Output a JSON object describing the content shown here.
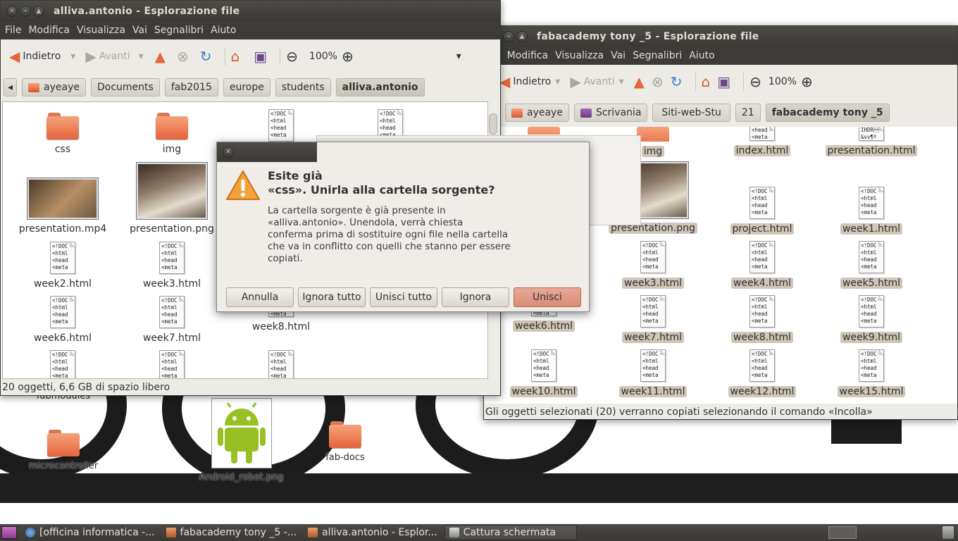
{
  "desktop": {
    "icons": [
      {
        "name": "microcontroller",
        "type": "folder"
      },
      {
        "name": "Android_robot.png",
        "type": "image"
      },
      {
        "name": "fab-docs",
        "type": "folder"
      }
    ],
    "partial_label": "fabmodules"
  },
  "window_left": {
    "title": "alliva.antonio - Esplorazione file",
    "menu": [
      "File",
      "Modifica",
      "Visualizza",
      "Vai",
      "Segnalibri",
      "Aiuto"
    ],
    "toolbar": {
      "back": "Indietro",
      "forward": "Avanti",
      "zoom": "100%"
    },
    "path": [
      "ayeaye",
      "Documents",
      "fab2015",
      "europe",
      "students",
      "alliva.antonio"
    ],
    "items": [
      {
        "name": "css",
        "type": "folder"
      },
      {
        "name": "img",
        "type": "folder"
      },
      {
        "name": "",
        "type": "html"
      },
      {
        "name": "",
        "type": "html"
      },
      {
        "name": "presentation.mp4",
        "type": "video"
      },
      {
        "name": "presentation.png",
        "type": "image"
      },
      {
        "name": "week2.html",
        "type": "html"
      },
      {
        "name": "week3.html",
        "type": "html"
      },
      {
        "name": "week6.html",
        "type": "html"
      },
      {
        "name": "week7.html",
        "type": "html"
      },
      {
        "name": "week8.html",
        "type": "html"
      },
      {
        "name": "",
        "type": "html"
      },
      {
        "name": "",
        "type": "html"
      },
      {
        "name": "",
        "type": "html"
      }
    ],
    "doc_preview": [
      "<!DOC",
      "<html",
      "<head",
      "<meta"
    ],
    "status": "20 oggetti, 6,6 GB di spazio libero"
  },
  "window_right": {
    "title": "fabacademy tony _5 - Esplorazione file",
    "menu": [
      "e",
      "Modifica",
      "Visualizza",
      "Vai",
      "Segnalibri",
      "Aiuto"
    ],
    "toolbar": {
      "back": "Indietro",
      "forward": "Avanti",
      "zoom": "100%"
    },
    "path": [
      "ayeaye",
      "Scrivania",
      "Siti-web-Stu",
      "21",
      "fabacademy tony _5"
    ],
    "items": [
      {
        "name": "img",
        "type": "folder"
      },
      {
        "name": "index.html",
        "type": "html"
      },
      {
        "name": "presentation.html",
        "type": "html"
      },
      {
        "name": "presentation.png",
        "type": "image"
      },
      {
        "name": "project.html",
        "type": "html"
      },
      {
        "name": "week1.html",
        "type": "html"
      },
      {
        "name": "week3.html",
        "type": "html"
      },
      {
        "name": "week4.html",
        "type": "html"
      },
      {
        "name": "week5.html",
        "type": "html"
      },
      {
        "name": "week6.html",
        "type": "html"
      },
      {
        "name": "week7.html",
        "type": "html"
      },
      {
        "name": "week8.html",
        "type": "html"
      },
      {
        "name": "week9.html",
        "type": "html"
      },
      {
        "name": "week10.html",
        "type": "html"
      },
      {
        "name": "week11.html",
        "type": "html"
      },
      {
        "name": "week12.html",
        "type": "html"
      },
      {
        "name": "week15.html",
        "type": "html"
      }
    ],
    "preview_partial": [
      "<head",
      "<meta"
    ],
    "preview_png": [
      "IHDR\u0001",
      "&vv¶º"
    ],
    "status": "Gli oggetti selezionati (20) verranno copiati selezionando il comando «Incolla»"
  },
  "dialog": {
    "heading_line1": "Esite già",
    "heading_line2": "«css». Unirla alla cartella sorgente?",
    "body": [
      "La cartella sorgente è già presente in",
      "«alliva.antonio». Unendola, verrà chiesta",
      "conferma prima di sostituire ogni file nella cartella",
      "che va in conflitto con quelli che stanno per essere",
      "copiati."
    ],
    "buttons": {
      "cancel": "Annulla",
      "skip_all": "Ignora tutto",
      "merge_all": "Unisci tutto",
      "skip": "Ignora",
      "merge": "Unisci"
    }
  },
  "taskbar": {
    "tasks": [
      "[officina informatica -...",
      "fabacademy tony _5 -...",
      "alliva.antonio - Esplor...",
      "Cattura schermata"
    ]
  }
}
